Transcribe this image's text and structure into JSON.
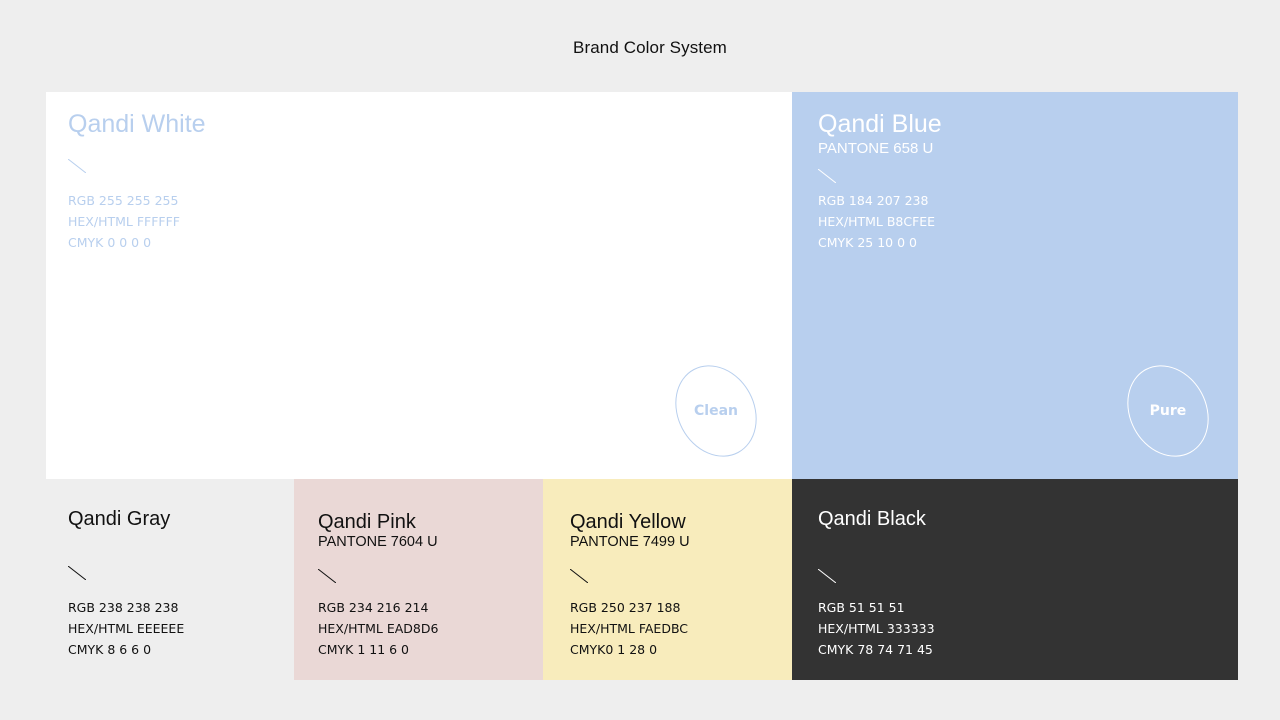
{
  "page": {
    "title": "Brand Color System"
  },
  "swatches": [
    {
      "name": "Qandi White",
      "pantone": "",
      "rgb": "RGB 255 255 255",
      "hex": "HEX/HTML FFFFFF",
      "cmyk": "CMYK 0 0 0 0",
      "keyword": "Clean",
      "background": "#FFFFFF",
      "text_color": "#B8CFEE"
    },
    {
      "name": "Qandi Blue",
      "pantone": "PANTONE 658 U",
      "rgb": "RGB 184 207 238",
      "hex": "HEX/HTML B8CFEE",
      "cmyk": "CMYK 25 10 0 0",
      "keyword": "Pure",
      "background": "#B8CFEE",
      "text_color": "#FFFFFF"
    },
    {
      "name": "Qandi Gray",
      "pantone": "",
      "rgb": "RGB 238 238 238",
      "hex": "HEX/HTML EEEEEE",
      "cmyk": "CMYK 8 6 6 0",
      "background": "#EEEEEE",
      "text_color": "#111111"
    },
    {
      "name": "Qandi Pink",
      "pantone": "PANTONE 7604 U",
      "rgb": "RGB 234 216 214",
      "hex": "HEX/HTML EAD8D6",
      "cmyk": "CMYK 1 11 6 0",
      "background": "#EAD8D6",
      "text_color": "#111111"
    },
    {
      "name": "Qandi Yellow",
      "pantone": "PANTONE 7499 U",
      "rgb": "RGB 250 237 188",
      "hex": "HEX/HTML FAEDBC",
      "cmyk": "CMYK0 1 28 0",
      "background": "#F8ECBC",
      "text_color": "#111111"
    },
    {
      "name": "Qandi Black",
      "pantone": "",
      "rgb": "RGB 51 51 51",
      "hex": "HEX/HTML 333333",
      "cmyk": "CMYK 78 74 71 45",
      "background": "#333333",
      "text_color": "#FFFFFF"
    }
  ]
}
